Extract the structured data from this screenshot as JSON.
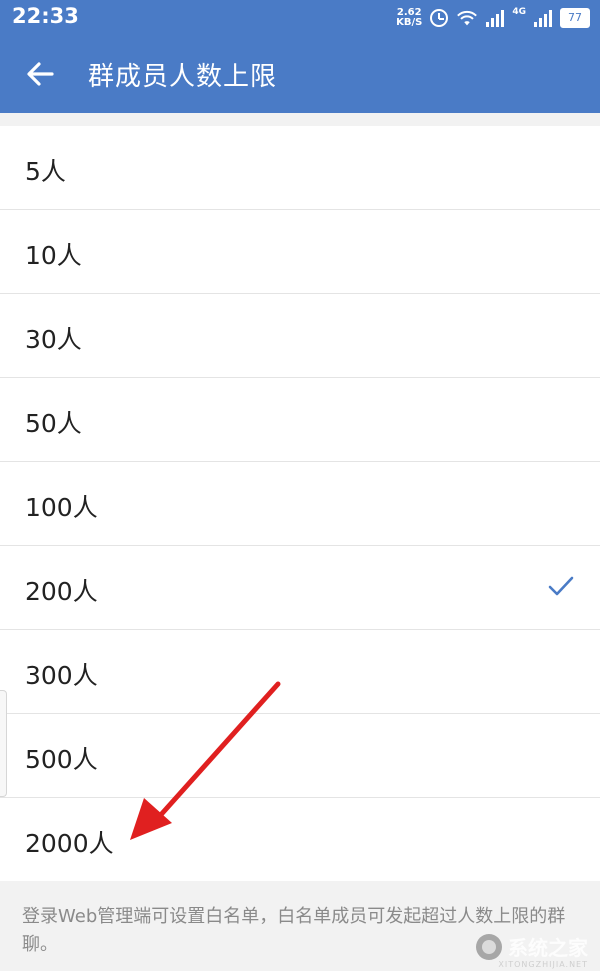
{
  "status_bar": {
    "time": "22:33",
    "net_speed_value": "2.62",
    "net_speed_unit": "KB/S",
    "network_type": "4G",
    "battery": "77"
  },
  "header": {
    "title": "群成员人数上限"
  },
  "options": [
    {
      "label": "5人",
      "selected": false
    },
    {
      "label": "10人",
      "selected": false
    },
    {
      "label": "30人",
      "selected": false
    },
    {
      "label": "50人",
      "selected": false
    },
    {
      "label": "100人",
      "selected": false
    },
    {
      "label": "200人",
      "selected": true
    },
    {
      "label": "300人",
      "selected": false
    },
    {
      "label": "500人",
      "selected": false
    },
    {
      "label": "2000人",
      "selected": false
    }
  ],
  "footer": {
    "note": "登录Web管理端可设置白名单，白名单成员可发起超过人数上限的群聊。"
  },
  "watermark": {
    "text": "系统之家",
    "subtext": "XITONGZHIJIA.NET"
  },
  "colors": {
    "header_bg": "#4a7bc6",
    "check": "#4a7bc6",
    "annotation_arrow": "#e02020"
  },
  "icons": {
    "back": "back-arrow-icon",
    "check": "check-icon",
    "alarm": "alarm-icon",
    "wifi": "wifi-icon",
    "signal": "signal-icon"
  }
}
